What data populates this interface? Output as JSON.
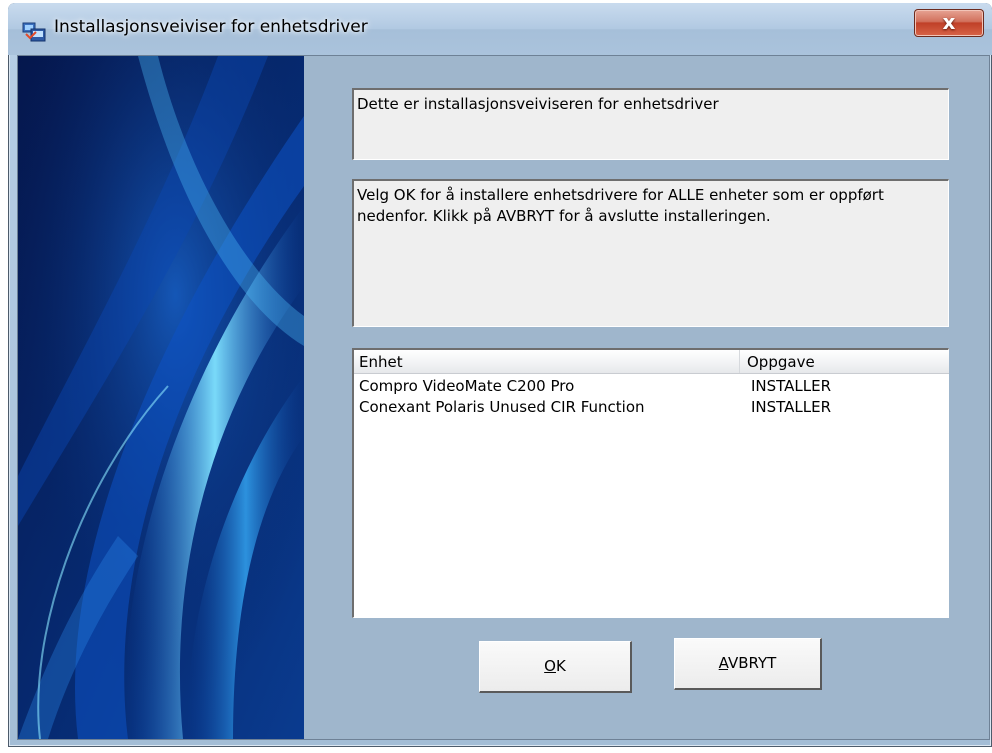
{
  "window": {
    "title": "Installasjonsveiviser for enhetsdriver",
    "close_glyph": "x"
  },
  "content": {
    "welcome_text": "Dette er installasjonsveiviseren for enhetsdriver",
    "instructions_text": "Velg OK for å installere enhetsdrivere for ALLE enheter som er oppført nedenfor. Klikk på AVBRYT for å avslutte installeringen."
  },
  "device_list": {
    "columns": [
      "Enhet",
      "Oppgave"
    ],
    "rows": [
      {
        "device": "Compro VideoMate C200 Pro",
        "task": "INSTALLER"
      },
      {
        "device": "Conexant Polaris Unused CIR Function",
        "task": "INSTALLER"
      }
    ]
  },
  "buttons": {
    "ok": {
      "mnemonic": "O",
      "rest": "K"
    },
    "cancel": {
      "mnemonic": "A",
      "rest": "VBRYT"
    }
  },
  "icons": {
    "window_icon": "installer-icon",
    "close": "close-icon"
  },
  "colors": {
    "titlebar": "#b1c9e2",
    "client_background": "#9fb6cc",
    "close_button": "#c04028"
  }
}
